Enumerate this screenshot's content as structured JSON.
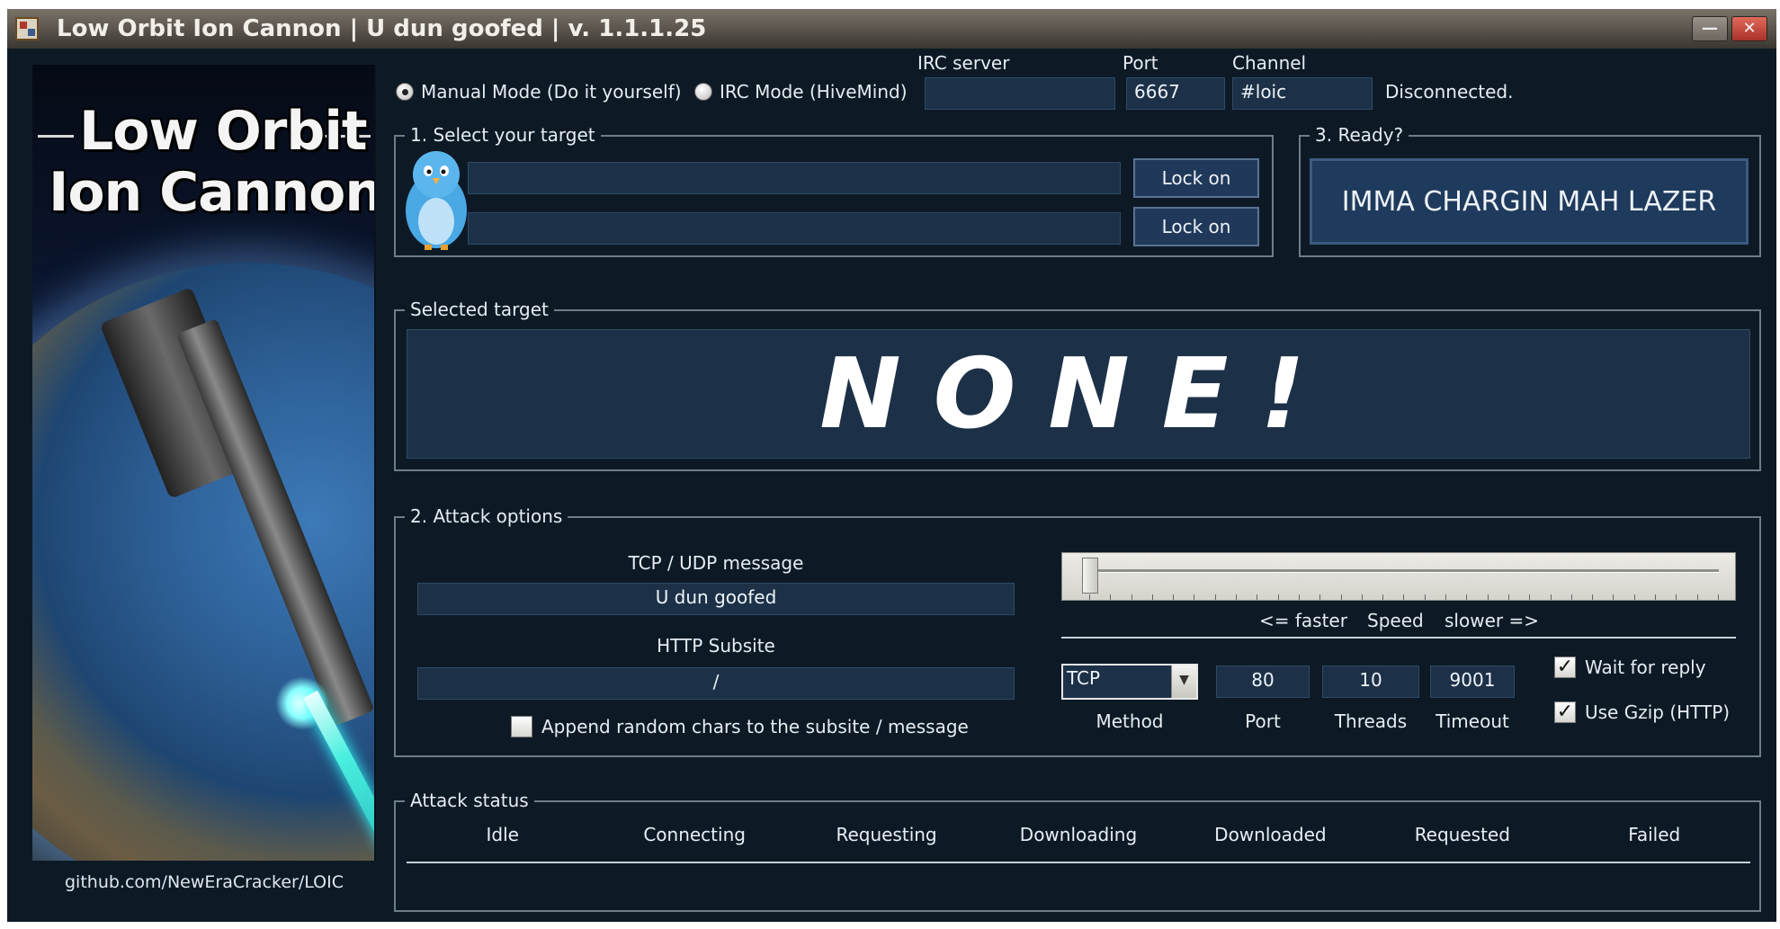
{
  "window": {
    "title": "Low Orbit Ion Cannon | U dun goofed | v. 1.1.1.25",
    "minimize_label": "—",
    "close_label": "✕"
  },
  "sidebar": {
    "logo_line1": "Low Orbit",
    "logo_line2": "Ion Cannon",
    "github": "github.com/NewEraCracker/LOIC"
  },
  "mode": {
    "manual_label": "Manual Mode (Do it yourself)",
    "irc_label": "IRC Mode (HiveMind)",
    "selected": "manual"
  },
  "irc": {
    "server_label": "IRC server",
    "server_value": "",
    "port_label": "Port",
    "port_value": "6667",
    "channel_label": "Channel",
    "channel_value": "#loic",
    "status": "Disconnected."
  },
  "target": {
    "group_title": "1. Select your target",
    "url_value": "",
    "ip_value": "",
    "lock_on_label": "Lock on",
    "lock_on_label_2": "Lock on"
  },
  "ready": {
    "group_title": "3. Ready?",
    "fire_label": "IMMA CHARGIN MAH LAZER"
  },
  "selected_target": {
    "group_title": "Selected target",
    "value": "NONE!"
  },
  "attack_options": {
    "group_title": "2. Attack options",
    "tcp_udp_label": "TCP / UDP message",
    "tcp_udp_value": "U dun goofed",
    "http_label": "HTTP Subsite",
    "http_value": "/",
    "append_label": "Append random chars to the subsite / message",
    "append_checked": false,
    "speed_faster": "<= faster",
    "speed_label": "Speed",
    "speed_slower": "slower =>",
    "speed_position": 0,
    "method_value": "TCP",
    "method_label": "Method",
    "port_value": "80",
    "port_label": "Port",
    "threads_value": "10",
    "threads_label": "Threads",
    "timeout_value": "9001",
    "timeout_label": "Timeout",
    "wait_reply_label": "Wait for reply",
    "wait_reply_checked": true,
    "gzip_label": "Use Gzip (HTTP)",
    "gzip_checked": true
  },
  "attack_status": {
    "group_title": "Attack status",
    "columns": [
      "Idle",
      "Connecting",
      "Requesting",
      "Downloading",
      "Downloaded",
      "Requested",
      "Failed"
    ]
  },
  "colors": {
    "background": "#0d1a26",
    "field": "#1c3147",
    "button": "#20395a"
  },
  "icons": {
    "app": "loic-app-icon",
    "bird": "twitter-bird-icon",
    "check": "checkmark-icon"
  }
}
